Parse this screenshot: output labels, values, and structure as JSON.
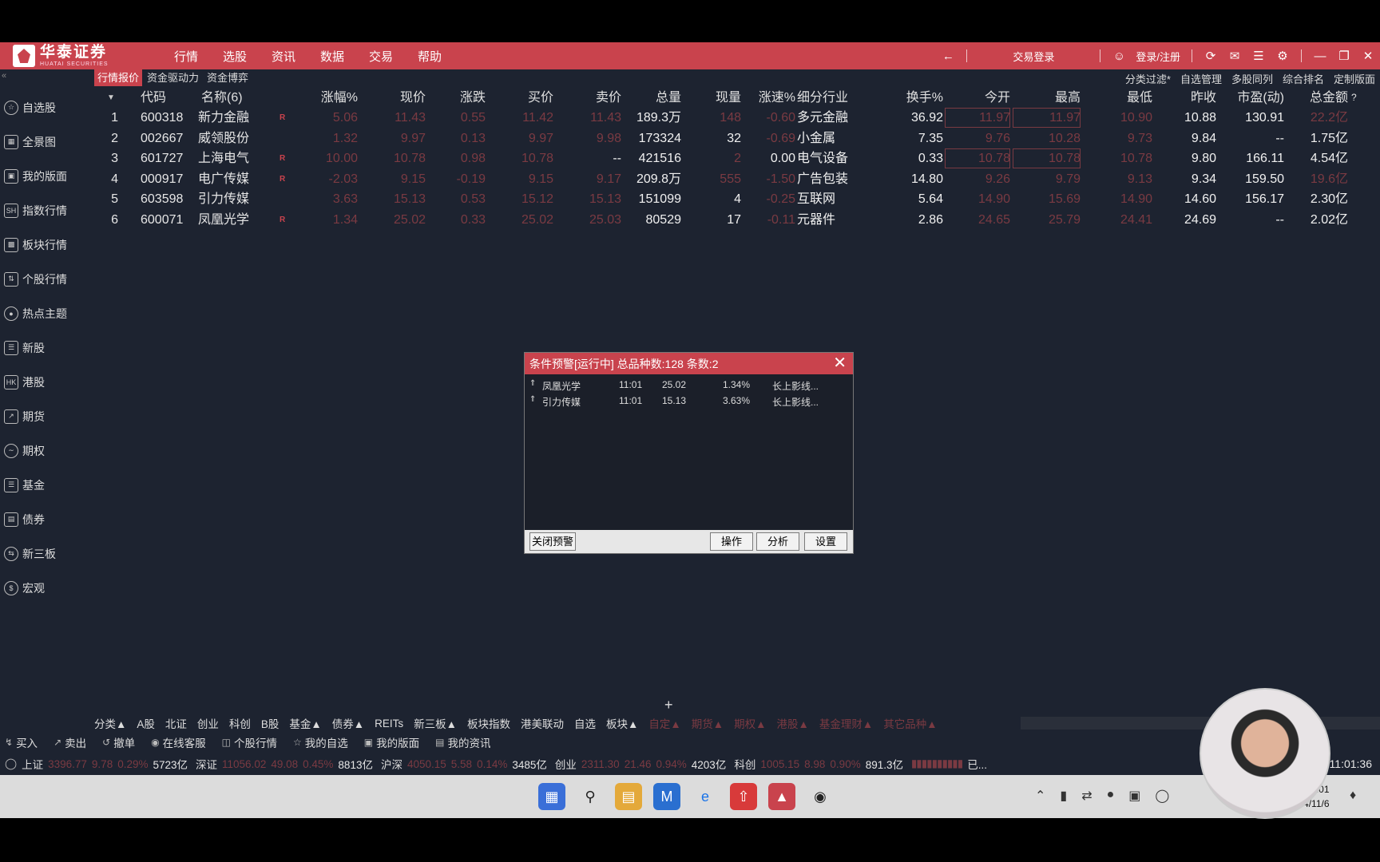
{
  "brand": {
    "name_cn": "华泰证券",
    "name_en": "HUATAI SECURITIES"
  },
  "menu": [
    "行情",
    "选股",
    "资讯",
    "数据",
    "交易",
    "帮助"
  ],
  "titlebar": {
    "trade_login": "交易登录",
    "login": "登录/注册"
  },
  "tabs": [
    "行情报价",
    "资金驱动力",
    "资金博弈"
  ],
  "right_links": [
    "分类过滤*",
    "自选管理",
    "多股同列",
    "综合排名",
    "定制版面"
  ],
  "sidebar": [
    {
      "label": "自选股",
      "icon": "star-icon"
    },
    {
      "label": "全景图",
      "icon": "panorama-icon"
    },
    {
      "label": "我的版面",
      "icon": "layout-icon"
    },
    {
      "label": "指数行情",
      "icon": "sh-index-icon"
    },
    {
      "label": "板块行情",
      "icon": "sector-icon"
    },
    {
      "label": "个股行情",
      "icon": "stock-icon"
    },
    {
      "label": "热点主题",
      "icon": "hot-topic-icon"
    },
    {
      "label": "新股",
      "icon": "ipo-icon"
    },
    {
      "label": "港股",
      "icon": "hk-icon"
    },
    {
      "label": "期货",
      "icon": "futures-icon"
    },
    {
      "label": "期权",
      "icon": "options-icon"
    },
    {
      "label": "基金",
      "icon": "fund-icon"
    },
    {
      "label": "债券",
      "icon": "bond-icon"
    },
    {
      "label": "新三板",
      "icon": "neeq-icon"
    },
    {
      "label": "宏观",
      "icon": "macro-icon"
    }
  ],
  "table": {
    "headers": [
      "代码",
      "名称(6)",
      "涨幅%",
      "现价",
      "涨跌",
      "买价",
      "卖价",
      "总量",
      "现量",
      "涨速%",
      "细分行业",
      "换手%",
      "今开",
      "最高",
      "最低",
      "昨收",
      "市盈(动)",
      "总金额"
    ],
    "rows": [
      {
        "no": "1",
        "code": "600318",
        "name": "新力金融",
        "r": "R",
        "zf": "5.06",
        "xj": "11.43",
        "zd": "0.55",
        "mr": "11.42",
        "mc": "11.43",
        "zl": "189.3万",
        "xl": "148",
        "zs": "-0.60",
        "hy": "多元金融",
        "hs": "36.92",
        "jk": "11.97",
        "zg": "11.97",
        "zdl": "10.90",
        "zs2": "10.88",
        "sy": "130.91",
        "ze": "22.2亿"
      },
      {
        "no": "2",
        "code": "002667",
        "name": "威领股份",
        "r": "",
        "zf": "1.32",
        "xj": "9.97",
        "zd": "0.13",
        "mr": "9.97",
        "mc": "9.98",
        "zl": "173324",
        "xl": "32",
        "zs": "-0.69",
        "hy": "小金属",
        "hs": "7.35",
        "jk": "9.76",
        "zg": "10.28",
        "zdl": "9.73",
        "zs2": "9.84",
        "sy": "--",
        "ze": "1.75亿"
      },
      {
        "no": "3",
        "code": "601727",
        "name": "上海电气",
        "r": "R",
        "zf": "10.00",
        "xj": "10.78",
        "zd": "0.98",
        "mr": "10.78",
        "mc": "--",
        "zl": "421516",
        "xl": "2",
        "zs": "0.00",
        "hy": "电气设备",
        "hs": "0.33",
        "jk": "10.78",
        "zg": "10.78",
        "zdl": "10.78",
        "zs2": "9.80",
        "sy": "166.11",
        "ze": "4.54亿"
      },
      {
        "no": "4",
        "code": "000917",
        "name": "电广传媒",
        "r": "R",
        "zf": "-2.03",
        "xj": "9.15",
        "zd": "-0.19",
        "mr": "9.15",
        "mc": "9.17",
        "zl": "209.8万",
        "xl": "555",
        "zs": "-1.50",
        "hy": "广告包装",
        "hs": "14.80",
        "jk": "9.26",
        "zg": "9.79",
        "zdl": "9.13",
        "zs2": "9.34",
        "sy": "159.50",
        "ze": "19.6亿"
      },
      {
        "no": "5",
        "code": "603598",
        "name": "引力传媒",
        "r": "",
        "zf": "3.63",
        "xj": "15.13",
        "zd": "0.53",
        "mr": "15.12",
        "mc": "15.13",
        "zl": "151099",
        "xl": "4",
        "zs": "-0.25",
        "hy": "互联网",
        "hs": "5.64",
        "jk": "14.90",
        "zg": "15.69",
        "zdl": "14.90",
        "zs2": "14.60",
        "sy": "156.17",
        "ze": "2.30亿"
      },
      {
        "no": "6",
        "code": "600071",
        "name": "凤凰光学",
        "r": "R",
        "zf": "1.34",
        "xj": "25.02",
        "zd": "0.33",
        "mr": "25.02",
        "mc": "25.03",
        "zl": "80529",
        "xl": "17",
        "zs": "-0.11",
        "hy": "元器件",
        "hs": "2.86",
        "jk": "24.65",
        "zg": "25.79",
        "zdl": "24.41",
        "zs2": "24.69",
        "sy": "--",
        "ze": "2.02亿"
      }
    ]
  },
  "alert_dialog": {
    "title": "条件预警[运行中] 总品种数:128 条数:2",
    "items": [
      {
        "name": "凤凰光学",
        "time": "11:01",
        "price": "25.02",
        "pct": "1.34%",
        "cond": "长上影线..."
      },
      {
        "name": "引力传媒",
        "time": "11:01",
        "price": "15.13",
        "pct": "3.63%",
        "cond": "长上影线..."
      }
    ],
    "buttons": {
      "close": "关闭预警",
      "operate": "操作",
      "analyze": "分析",
      "settings": "设置"
    }
  },
  "category_bar": {
    "bright": [
      "分类▲",
      "A股",
      "北证",
      "创业",
      "科创",
      "B股",
      "基金▲",
      "债券▲",
      "REITs",
      "新三板▲",
      "板块指数",
      "港美联动",
      "自选",
      "板块▲"
    ],
    "dim": [
      "自定▲",
      "期货▲",
      "期权▲",
      "港股▲",
      "基金理财▲",
      "其它品种▲"
    ]
  },
  "action_bar": [
    "买入",
    "卖出",
    "撤单",
    "在线客服",
    "个股行情",
    "我的自选",
    "我的版面",
    "我的资讯"
  ],
  "ticker": [
    {
      "label": "上证",
      "value": "3396.77",
      "change": "9.78",
      "pct": "0.29%",
      "amount": "5723亿"
    },
    {
      "label": "深证",
      "value": "11056.02",
      "change": "49.08",
      "pct": "0.45%",
      "amount": "8813亿"
    },
    {
      "label": "沪深",
      "value": "4050.15",
      "change": "5.58",
      "pct": "0.14%",
      "amount": "3485亿"
    },
    {
      "label": "创业",
      "value": "2311.30",
      "change": "21.46",
      "pct": "0.94%",
      "amount": "4203亿"
    },
    {
      "label": "科创",
      "value": "1005.15",
      "change": "8.98",
      "pct": "0.90%",
      "amount": "891.3亿"
    }
  ],
  "ticker_extra": "已...",
  "ticker_time": "11:01:36",
  "taskbar_clock": {
    "time": "11:01",
    "date": "2024/11/6"
  },
  "colors": {
    "accent": "#c9434d",
    "background": "#1d2330",
    "dim_red": "#7a3a42"
  }
}
